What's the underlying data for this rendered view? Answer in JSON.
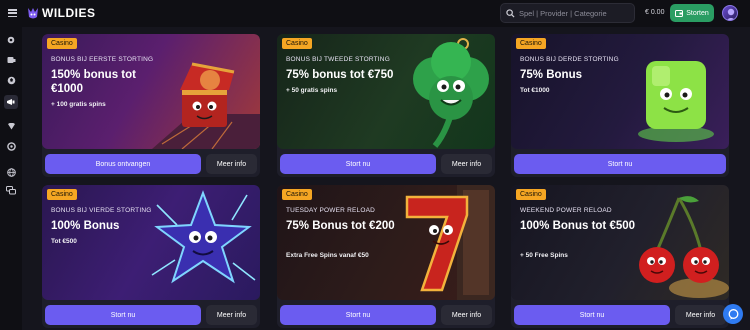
{
  "brand": {
    "name": "WILDIES",
    "accent": "#6b5cf0",
    "tag_color": "#f5a623",
    "deposit_color": "#2a9d63"
  },
  "header": {
    "search_placeholder": "Spel | Provider | Categorie",
    "balance": "€ 0.00",
    "deposit_label": "Storten"
  },
  "sidebar": {
    "icons": [
      "menu-icon",
      "bonus-icon",
      "casino-icon",
      "sports-icon",
      "promotions-icon",
      "vip-icon",
      "tournament-icon",
      "language-icon",
      "support-chat-icon"
    ]
  },
  "cards": [
    {
      "tag": "Casino",
      "subtitle": "BONUS BIJ EERSTE STORTING",
      "title": "150% bonus tot €1000",
      "extra": "+ 100 gratis spins",
      "primary": "Bonus ontvangen",
      "secondary": "Meer info"
    },
    {
      "tag": "Casino",
      "subtitle": "BONUS BIJ TWEEDE STORTING",
      "title": "75% bonus tot €750",
      "extra": "+ 50 gratis spins",
      "primary": "Stort nu",
      "secondary": "Meer info"
    },
    {
      "tag": "Casino",
      "subtitle": "BONUS BIJ DERDE STORTING",
      "title": "75% Bonus",
      "extra": "Tot €1000",
      "primary": "Stort nu",
      "secondary": "Meer info"
    },
    {
      "tag": "Casino",
      "subtitle": "BONUS BIJ VIERDE STORTING",
      "title": "100% Bonus",
      "extra": "Tot €500",
      "primary": "Stort nu",
      "secondary": "Meer info"
    },
    {
      "tag": "Casino",
      "subtitle": "TUESDAY POWER RELOAD",
      "title": "75% Bonus tot €200",
      "extra": "Extra Free Spins vanaf €50",
      "primary": "Stort nu",
      "secondary": "Meer info"
    },
    {
      "tag": "Casino",
      "subtitle": "WEEKEND POWER RELOAD",
      "title": "100% Bonus tot €500",
      "extra": "+ 50 Free Spins",
      "primary": "Stort nu",
      "secondary": "Meer info"
    }
  ]
}
